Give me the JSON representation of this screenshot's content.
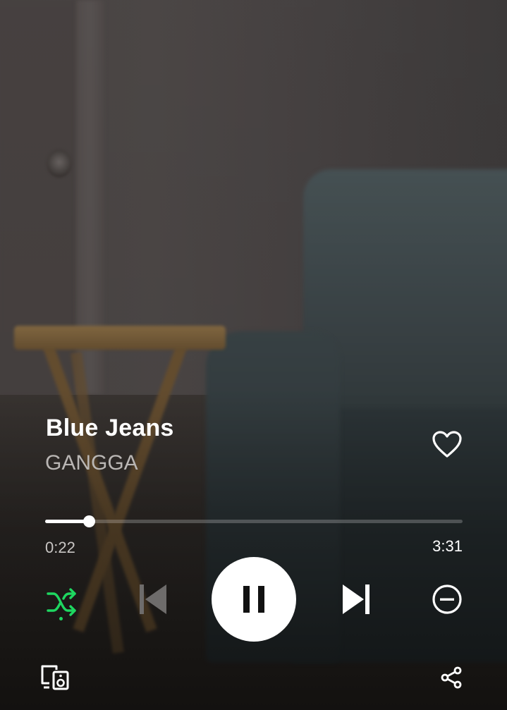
{
  "track": {
    "title": "Blue Jeans",
    "artist": "GANGGA",
    "liked": false
  },
  "playback": {
    "elapsed": "0:22",
    "total": "3:31",
    "progress_fraction": 0.104,
    "state": "playing",
    "shuffle_enabled": true
  },
  "icons": {
    "like": "heart-outline-icon",
    "shuffle": "shuffle-icon",
    "previous": "skip-previous-icon",
    "play_pause": "pause-icon",
    "next": "skip-next-icon",
    "hide": "minus-circle-icon",
    "devices": "connect-devices-icon",
    "share": "share-icon"
  },
  "colors": {
    "accent": "#1ed760",
    "text_primary": "#ffffff",
    "text_secondary": "#b9b6b4",
    "previous_disabled": "#6e6c6b"
  }
}
